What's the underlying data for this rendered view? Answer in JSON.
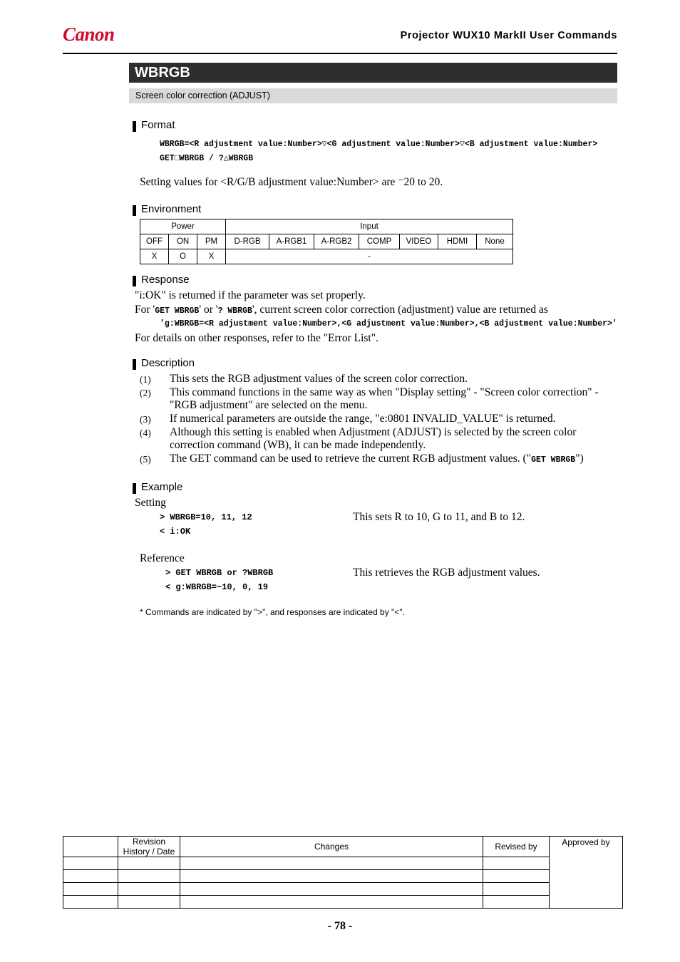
{
  "header": {
    "logo_text": "Canon",
    "title": "Projector  WUX10 MarkII  User  Commands"
  },
  "command": {
    "name": "WBRGB",
    "subtitle": "Screen color correction (ADJUST)"
  },
  "sections": {
    "format": "Format",
    "environment": "Environment",
    "response": "Response",
    "description": "Description",
    "example": "Example"
  },
  "format": {
    "line1": "WBRGB=<R adjustment value:Number>▽<G adjustment value:Number>▽<B adjustment value:Number>",
    "line2": "GET□WBRGB   /   ?△WBRGB",
    "note": "Setting values for <R/G/B adjustment value:Number> are ⁻20 to 20."
  },
  "environment_table": {
    "group_power": "Power",
    "group_input": "Input",
    "power_cols": [
      "OFF",
      "ON",
      "PM"
    ],
    "input_cols": [
      "D-RGB",
      "A-RGB1",
      "A-RGB2",
      "COMP",
      "VIDEO",
      "HDMI",
      "None"
    ],
    "power_values": [
      "X",
      "O",
      "X"
    ],
    "input_value": "-"
  },
  "response": {
    "line1": "\"i:OK\" is returned if the parameter was set properly.",
    "line2_pre": "For '",
    "line2_code1": "GET WBRGB",
    "line2_mid": "' or '",
    "line2_code2": "? WBRGB",
    "line2_post": "', current screen color correction (adjustment) value are returned as",
    "line3": "'g:WBRGB=<R adjustment value:Number>,<G adjustment value:Number>,<B adjustment value:Number>'",
    "line4": "For details on other responses, refer to the \"Error List\"."
  },
  "description_items": [
    {
      "num": "(1)",
      "text": "This sets the RGB adjustment values of the screen color correction."
    },
    {
      "num": "(2)",
      "text": "This command functions in the same way as when \"Display setting\" - \"Screen color correction\" - \"RGB adjustment\" are selected on the menu."
    },
    {
      "num": "(3)",
      "text": "If numerical parameters are outside the range, \"e:0801 INVALID_VALUE\" is returned."
    },
    {
      "num": "(4)",
      "text": "Although this setting is enabled when Adjustment (ADJUST) is selected by the screen color correction command (WB), it can be made independently."
    },
    {
      "num": "(5)",
      "text_pre": "The GET command can be used to retrieve the current RGB adjustment values. (\"",
      "code": "GET WBRGB",
      "text_post": "\")"
    }
  ],
  "example": {
    "setting_label": "Setting",
    "setting_cmd": "> WBRGB=10, 11, 12",
    "setting_cmd_desc": "This sets R to 10, G to 11, and B to 12.",
    "setting_resp": "< i:OK",
    "reference_label": "Reference",
    "reference_cmd": "> GET WBRGB or ?WBRGB",
    "reference_cmd_desc": "This retrieves the RGB adjustment values.",
    "reference_resp": "< g:WBRGB=−10, 0, 19",
    "footnote": "* Commands are indicated by \">\", and responses are indicated by \"<\"."
  },
  "revision_table": {
    "headers": [
      "Revision History / Date",
      "Changes",
      "Revised by",
      "Approved by"
    ],
    "rows": [
      [
        "",
        "",
        "",
        "",
        ""
      ],
      [
        "",
        "",
        "",
        "",
        ""
      ],
      [
        "",
        "",
        "",
        "",
        ""
      ],
      [
        "",
        "",
        "",
        "",
        ""
      ]
    ]
  },
  "page_number": "- 78 -"
}
